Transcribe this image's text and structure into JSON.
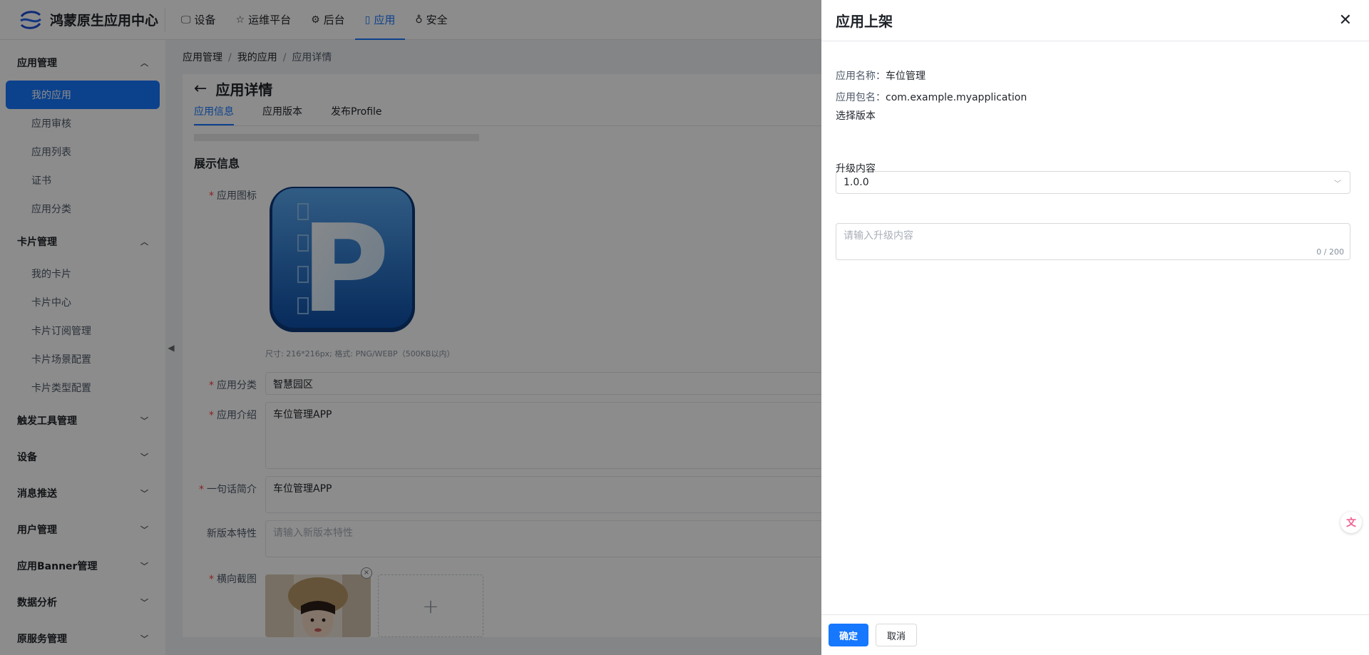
{
  "app": {
    "title": "鸿蒙原生应用中心"
  },
  "topnav": [
    {
      "label": "设备",
      "icon": "monitor-icon",
      "glyph": "🖵",
      "active": false
    },
    {
      "label": "运维平台",
      "icon": "star-icon",
      "glyph": "☆",
      "active": false
    },
    {
      "label": "后台",
      "icon": "gear-icon",
      "glyph": "⚙",
      "active": false
    },
    {
      "label": "应用",
      "icon": "phone-icon",
      "glyph": "▯",
      "active": true
    },
    {
      "label": "安全",
      "icon": "lock-icon",
      "glyph": "♁",
      "active": false
    }
  ],
  "sidebar": {
    "app_mgmt": {
      "label": "应用管理",
      "items": [
        "我的应用",
        "应用审核",
        "应用列表",
        "证书",
        "应用分类"
      ]
    },
    "card_mgmt": {
      "label": "卡片管理",
      "items": [
        "我的卡片",
        "卡片中心",
        "卡片订阅管理",
        "卡片场景配置",
        "卡片类型配置"
      ]
    },
    "others": [
      "触发工具管理",
      "设备",
      "消息推送",
      "用户管理",
      "应用Banner管理",
      "数据分析",
      "原服务管理"
    ]
  },
  "breadcrumb": [
    "应用管理",
    "我的应用",
    "应用详情"
  ],
  "page": {
    "title": "应用详情",
    "tabs": [
      "应用信息",
      "应用版本",
      "发布Profile"
    ],
    "section": "展示信息",
    "labels": {
      "icon": "应用图标",
      "category": "应用分类",
      "intro": "应用介绍",
      "summary": "一句话简介",
      "features": "新版本特性",
      "screenshots": "横向截图"
    },
    "icon_letter": "P",
    "icon_hint": "尺寸: 216*216px; 格式: PNG/WEBP（500KB以内）",
    "category_value": "智慧园区",
    "intro_value": "车位管理APP",
    "summary_value": "车位管理APP",
    "features_placeholder": "请输入新版本特性",
    "upload_plus": "+"
  },
  "drawer": {
    "title": "应用上架",
    "name_label": "应用名称：",
    "name_value": "车位管理",
    "package_label": "应用包名：",
    "package_value": "com.example.myapplication",
    "version_label": "选择版本",
    "version_value": "1.0.0",
    "content_label": "升级内容",
    "content_placeholder": "请输入升级内容",
    "counter": "0 / 200",
    "ok": "确定",
    "cancel": "取消"
  },
  "colors": {
    "primary": "#1677ff",
    "required": "#f53f3f"
  }
}
